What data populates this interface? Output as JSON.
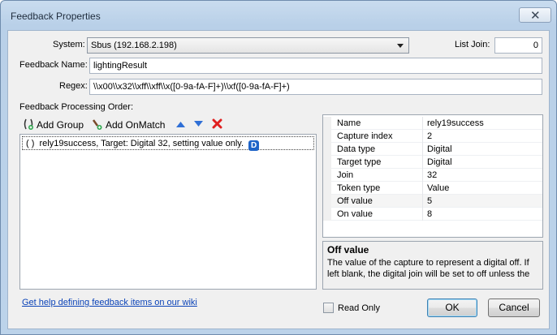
{
  "window": {
    "title": "Feedback Properties",
    "close_glyph": "✕"
  },
  "form": {
    "system_label": "System:",
    "system_value": "Sbus (192.168.2.198)",
    "list_join_label": "List Join:",
    "list_join_value": "0",
    "feedback_name_label": "Feedback Name:",
    "feedback_name_value": "lightingResult",
    "regex_label": "Regex:",
    "regex_value": "\\\\x00\\\\x32\\\\xff\\\\xff\\\\x([0-9a-fA-F]+)\\\\xf([0-9a-fA-F]+)",
    "processing_order_label": "Feedback Processing Order:"
  },
  "toolbar": {
    "add_group_label": "Add Group",
    "add_onmatch_label": "Add OnMatch"
  },
  "list": {
    "items": [
      {
        "prefix": "( )",
        "text": "rely19success, Target: Digital 32, setting value only.",
        "badge": "D"
      }
    ]
  },
  "properties": [
    {
      "name": "Name",
      "value": "rely19success"
    },
    {
      "name": "Capture index",
      "value": "2"
    },
    {
      "name": "Data type",
      "value": "Digital"
    },
    {
      "name": "Target type",
      "value": "Digital"
    },
    {
      "name": "Join",
      "value": "32"
    },
    {
      "name": "Token type",
      "value": "Value"
    },
    {
      "name": "Off value",
      "value": "5"
    },
    {
      "name": "On value",
      "value": "8"
    }
  ],
  "help": {
    "title": "Off value",
    "text": "The value of the capture to represent a digital off. If left blank, the digital join will be set to off unless the capt..."
  },
  "footer": {
    "wiki_link": "Get help defining feedback items on our wiki",
    "read_only_label": "Read Only",
    "ok_label": "OK",
    "cancel_label": "Cancel"
  },
  "colors": {
    "link": "#0b43b8",
    "badge": "#1e64c8",
    "delete_icon": "#e02020",
    "arrow_icon": "#2f6fd6"
  },
  "icons": [
    "add-group-icon",
    "add-onmatch-icon",
    "move-up-icon",
    "move-down-icon",
    "delete-icon",
    "close-icon"
  ]
}
